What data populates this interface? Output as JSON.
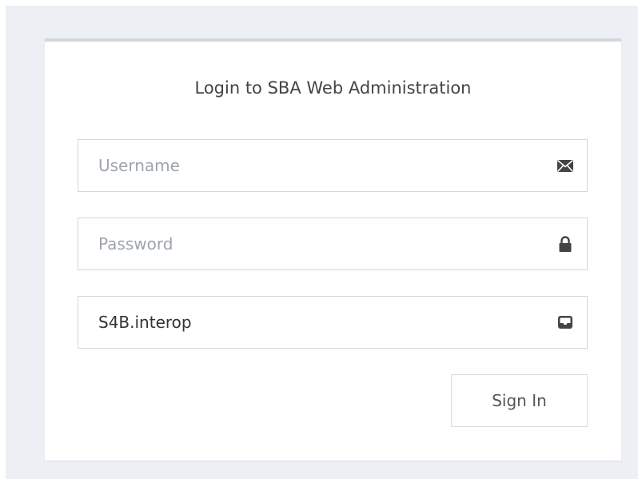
{
  "login": {
    "title": "Login to SBA Web Administration",
    "username": {
      "placeholder": "Username",
      "value": ""
    },
    "password": {
      "placeholder": "Password",
      "value": ""
    },
    "domain": {
      "value": "S4B.interop"
    },
    "signin_label": "Sign In",
    "icons": {
      "username": "envelope-icon",
      "password": "lock-icon",
      "domain": "inbox-tray-icon"
    }
  },
  "colors": {
    "page_background": "#ecf0f5",
    "card_background": "#ffffff",
    "card_top_border": "#d2d6de",
    "field_border": "#d2d6de",
    "placeholder_text": "#9ea4ac",
    "icon": "#444444"
  }
}
